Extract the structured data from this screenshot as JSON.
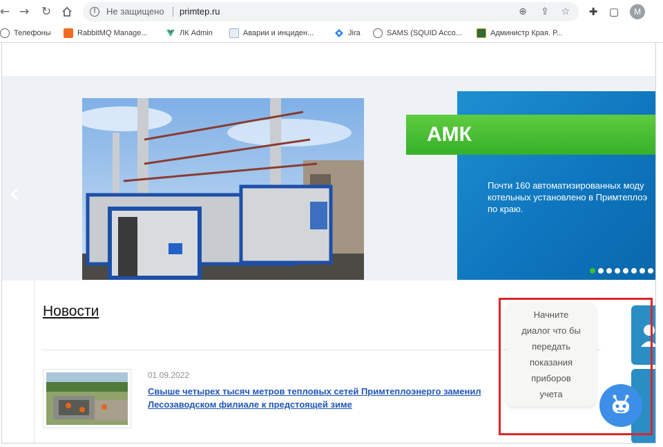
{
  "browser": {
    "security_status": "Не защищено",
    "url": "primtep.ru",
    "profile_initial": "M",
    "bookmarks": [
      {
        "label": "Телефоны",
        "icon": "globe-icon"
      },
      {
        "label": "RabbitMQ Manage...",
        "icon": "rabbitmq-icon"
      },
      {
        "label": "ЛК Admin",
        "icon": "vue-icon"
      },
      {
        "label": "Аварии и инциден...",
        "icon": "document-icon"
      },
      {
        "label": "Jira",
        "icon": "jira-icon"
      },
      {
        "label": "SAMS (SQUID Acco...",
        "icon": "globe-icon"
      },
      {
        "label": "Администр Края. Р...",
        "icon": "emblem-icon"
      }
    ]
  },
  "slider": {
    "slide_title": "АМК",
    "slide_text": "Почти 160 автоматизированных моду\nкотельных установлено в Примтеплоэ\nпо краю.",
    "dots_total": 9,
    "active_dot": 1,
    "colors": {
      "accent_green": "#36b02a",
      "blue": "#0e76bf"
    }
  },
  "news": {
    "heading": "Новости",
    "items": [
      {
        "date": "01.09.2022",
        "title_line1": "Свыше четырех тысяч метров тепловых сетей Примтеплоэнерго заменил",
        "title_line2": "Лесозаводском филиале к предстоящей зиме"
      }
    ]
  },
  "chat": {
    "tooltip": "Начните\nдиалог что бы\nпередать\nпоказания\nприборов\nучета"
  }
}
